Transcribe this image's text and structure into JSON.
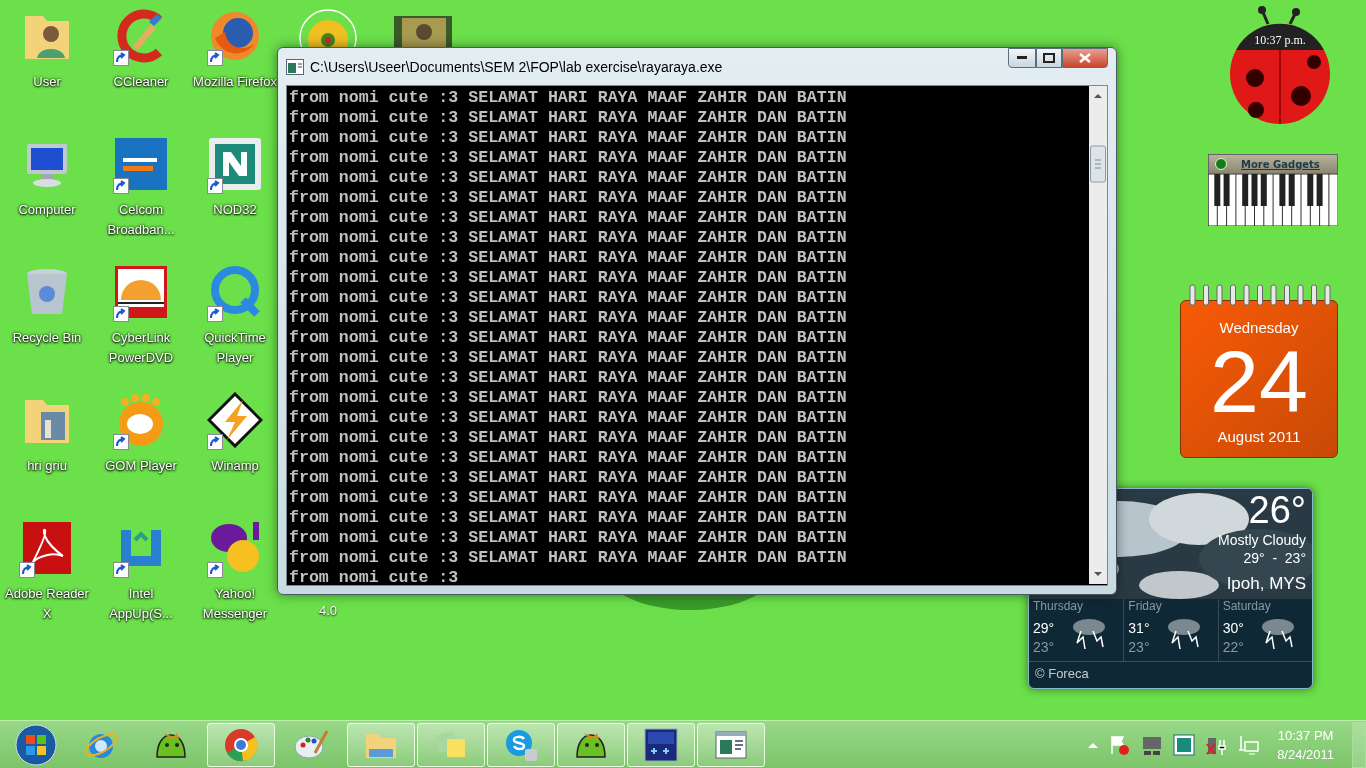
{
  "desktop_icons": [
    {
      "label": "User",
      "kind": "user-folder",
      "shortcut": false
    },
    {
      "label": "CCleaner",
      "kind": "cleaner",
      "shortcut": true
    },
    {
      "label": "Mozilla Firefox",
      "kind": "browser",
      "shortcut": true
    },
    {
      "label": "Computer",
      "kind": "computer",
      "shortcut": false
    },
    {
      "label": "Celcom Broadban...",
      "kind": "blue-tile",
      "shortcut": true
    },
    {
      "label": "NOD32",
      "kind": "teal-tile",
      "shortcut": true
    },
    {
      "label": "Recycle Bin",
      "kind": "bin",
      "shortcut": false
    },
    {
      "label": "CyberLink PowerDVD",
      "kind": "dvd",
      "shortcut": true
    },
    {
      "label": "QuickTime Player",
      "kind": "quicktime",
      "shortcut": true
    },
    {
      "label": "hri griu",
      "kind": "photo-folder",
      "shortcut": false
    },
    {
      "label": "GOM Player",
      "kind": "gom",
      "shortcut": true
    },
    {
      "label": "Winamp",
      "kind": "bolt",
      "shortcut": true
    },
    {
      "label": "Adobe Reader X",
      "kind": "pdf",
      "shortcut": true
    },
    {
      "label": "Intel AppUp(S...",
      "kind": "intel",
      "shortcut": true
    },
    {
      "label": "Yahoo! Messenger",
      "kind": "messenger",
      "shortcut": true
    }
  ],
  "hidden_icon_label": "4.0",
  "console": {
    "title": "C:\\Users\\Useer\\Documents\\SEM 2\\FOP\\lab exercise\\rayaraya.exe",
    "lines": [
      "from nomi cute :3 SELAMAT HARI RAYA MAAF ZAHIR DAN BATIN",
      "from nomi cute :3 SELAMAT HARI RAYA MAAF ZAHIR DAN BATIN",
      "from nomi cute :3 SELAMAT HARI RAYA MAAF ZAHIR DAN BATIN",
      "from nomi cute :3 SELAMAT HARI RAYA MAAF ZAHIR DAN BATIN",
      "from nomi cute :3 SELAMAT HARI RAYA MAAF ZAHIR DAN BATIN",
      "from nomi cute :3 SELAMAT HARI RAYA MAAF ZAHIR DAN BATIN",
      "from nomi cute :3 SELAMAT HARI RAYA MAAF ZAHIR DAN BATIN",
      "from nomi cute :3 SELAMAT HARI RAYA MAAF ZAHIR DAN BATIN",
      "from nomi cute :3 SELAMAT HARI RAYA MAAF ZAHIR DAN BATIN",
      "from nomi cute :3 SELAMAT HARI RAYA MAAF ZAHIR DAN BATIN",
      "from nomi cute :3 SELAMAT HARI RAYA MAAF ZAHIR DAN BATIN",
      "from nomi cute :3 SELAMAT HARI RAYA MAAF ZAHIR DAN BATIN",
      "from nomi cute :3 SELAMAT HARI RAYA MAAF ZAHIR DAN BATIN",
      "from nomi cute :3 SELAMAT HARI RAYA MAAF ZAHIR DAN BATIN",
      "from nomi cute :3 SELAMAT HARI RAYA MAAF ZAHIR DAN BATIN",
      "from nomi cute :3 SELAMAT HARI RAYA MAAF ZAHIR DAN BATIN",
      "from nomi cute :3 SELAMAT HARI RAYA MAAF ZAHIR DAN BATIN",
      "from nomi cute :3 SELAMAT HARI RAYA MAAF ZAHIR DAN BATIN",
      "from nomi cute :3 SELAMAT HARI RAYA MAAF ZAHIR DAN BATIN",
      "from nomi cute :3 SELAMAT HARI RAYA MAAF ZAHIR DAN BATIN",
      "from nomi cute :3 SELAMAT HARI RAYA MAAF ZAHIR DAN BATIN",
      "from nomi cute :3 SELAMAT HARI RAYA MAAF ZAHIR DAN BATIN",
      "from nomi cute :3 SELAMAT HARI RAYA MAAF ZAHIR DAN BATIN",
      "from nomi cute :3 SELAMAT HARI RAYA MAAF ZAHIR DAN BATIN",
      "from nomi cute :3"
    ]
  },
  "clock_gadget": {
    "time": "10:37 p.m."
  },
  "piano_gadget": {
    "link": "More Gadgets"
  },
  "calendar_gadget": {
    "weekday": "Wednesday",
    "day": "24",
    "month_year": "August 2011"
  },
  "weather_gadget": {
    "temperature": "26°",
    "condition": "Mostly Cloudy",
    "range": "29°  -  23°",
    "location": "Ipoh, MYS",
    "forecast": [
      {
        "day": "Thursday",
        "high": "29°",
        "low": "23°"
      },
      {
        "day": "Friday",
        "high": "31°",
        "low": "23°"
      },
      {
        "day": "Saturday",
        "high": "30°",
        "low": "22°"
      }
    ],
    "credit": "© Foreca"
  },
  "taskbar": {
    "items": [
      {
        "kind": "ie",
        "running": false
      },
      {
        "kind": "bird",
        "running": false
      },
      {
        "kind": "chrome",
        "running": true
      },
      {
        "kind": "palette",
        "running": false
      },
      {
        "kind": "folder",
        "running": true
      },
      {
        "kind": "notes",
        "running": true
      },
      {
        "kind": "skype",
        "running": true
      },
      {
        "kind": "bird",
        "running": true
      },
      {
        "kind": "dev",
        "running": true
      },
      {
        "kind": "console",
        "running": true
      }
    ],
    "time": "10:37 PM",
    "date": "8/24/2011"
  }
}
